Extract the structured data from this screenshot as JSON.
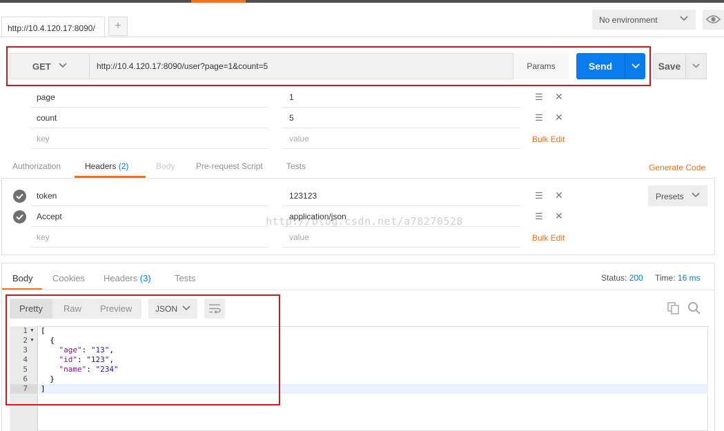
{
  "request_tab": {
    "title": "http://10.4.120.17:8090/",
    "add_label": "+"
  },
  "environment": {
    "selected": "No environment"
  },
  "request": {
    "method": "GET",
    "url": "http://10.4.120.17:8090/user?page=1&count=5",
    "params_label": "Params",
    "send_label": "Send",
    "save_label": "Save"
  },
  "params": {
    "rows": [
      {
        "key": "page",
        "value": "1"
      },
      {
        "key": "count",
        "value": "5"
      }
    ],
    "key_placeholder": "key",
    "value_placeholder": "value",
    "bulk_edit_label": "Bulk Edit"
  },
  "request_tabs": {
    "authorization": "Authorization",
    "headers": "Headers",
    "headers_count": "(2)",
    "body": "Body",
    "prerequest": "Pre-request Script",
    "tests": "Tests",
    "generate_code": "Generate Code"
  },
  "headers": {
    "rows": [
      {
        "key": "token",
        "value": "123123"
      },
      {
        "key": "Accept",
        "value": "application/json"
      }
    ],
    "key_placeholder": "key",
    "value_placeholder": "value",
    "bulk_edit_label": "Bulk Edit",
    "presets_label": "Presets"
  },
  "watermark": "http://blog.csdn.net/a78270528",
  "response_tabs": {
    "body": "Body",
    "cookies": "Cookies",
    "headers": "Headers",
    "headers_count": "(3)",
    "tests": "Tests"
  },
  "response_status": {
    "status_label": "Status:",
    "status_value": "200",
    "time_label": "Time:",
    "time_value": "16 ms"
  },
  "response_view": {
    "pretty": "Pretty",
    "raw": "Raw",
    "preview": "Preview",
    "format": "JSON"
  },
  "response_body": {
    "line_numbers": [
      "1",
      "2",
      "3",
      "4",
      "5",
      "6",
      "7"
    ],
    "line1": "[",
    "line2": "  {",
    "age_key": "\"age\"",
    "age_val": "\"13\"",
    "id_key": "\"id\"",
    "id_val": "\"123\"",
    "name_key": "\"name\"",
    "name_val": "\"234\"",
    "line6": "  }",
    "line7": "]"
  },
  "colors": {
    "accent": "#f47023",
    "send_blue": "#097bed",
    "highlight_red": "#d2161d"
  }
}
